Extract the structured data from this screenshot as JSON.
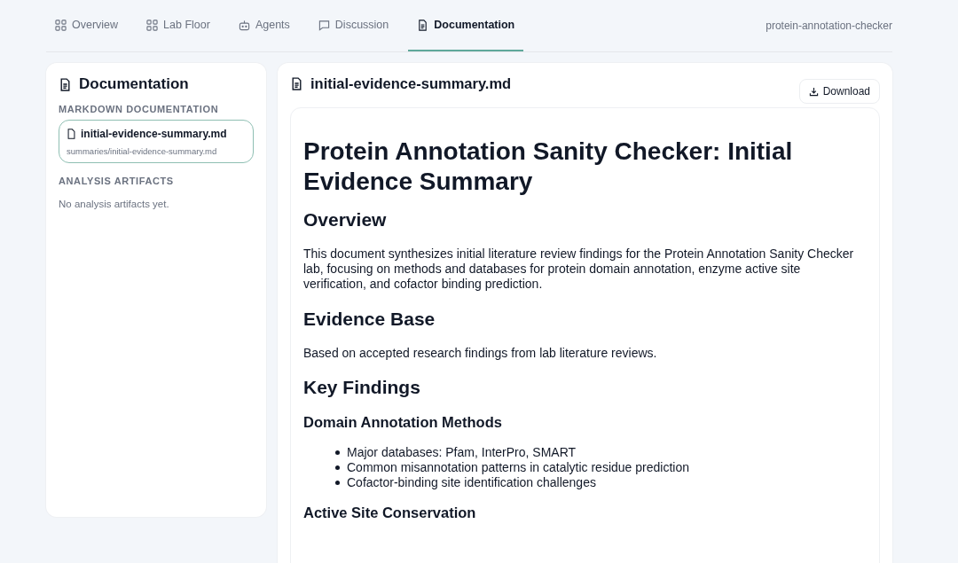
{
  "tabs": [
    {
      "label": "Overview",
      "selected": false
    },
    {
      "label": "Lab Floor",
      "selected": false
    },
    {
      "label": "Agents",
      "selected": false
    },
    {
      "label": "Discussion",
      "selected": false
    },
    {
      "label": "Documentation",
      "selected": true
    }
  ],
  "project": "protein-annotation-checker",
  "sidebar": {
    "title": "Documentation",
    "sections": [
      {
        "heading": "MARKDOWN DOCUMENTATION",
        "files": [
          {
            "name": "initial-evidence-summary.md",
            "path": "summaries/initial-evidence-summary.md",
            "selected": true
          }
        ]
      },
      {
        "heading": "ANALYSIS ARTIFACTS",
        "empty": "No analysis artifacts yet."
      }
    ]
  },
  "document": {
    "title": "initial-evidence-summary.md",
    "download": "Download",
    "blocks": [
      {
        "kind": "h1",
        "text": "Protein Annotation Sanity Checker: Initial Evidence Summary"
      },
      {
        "kind": "h2",
        "text": "Overview"
      },
      {
        "kind": "p",
        "text": "This document synthesizes initial literature review findings for the Protein Annotation Sanity Checker lab, focusing on methods and databases for protein domain annotation, enzyme active site verification, and cofactor binding prediction."
      },
      {
        "kind": "h2",
        "text": "Evidence Base"
      },
      {
        "kind": "p",
        "text": "Based on accepted research findings from lab literature reviews."
      },
      {
        "kind": "h2",
        "text": "Key Findings"
      },
      {
        "kind": "h3",
        "text": "Domain Annotation Methods"
      },
      {
        "kind": "ul",
        "items": [
          "Major databases: Pfam, InterPro, SMART",
          "Common misannotation patterns in catalytic residue prediction",
          "Cofactor-binding site identification challenges"
        ]
      },
      {
        "kind": "h3",
        "text": "Active Site Conservation"
      }
    ]
  }
}
